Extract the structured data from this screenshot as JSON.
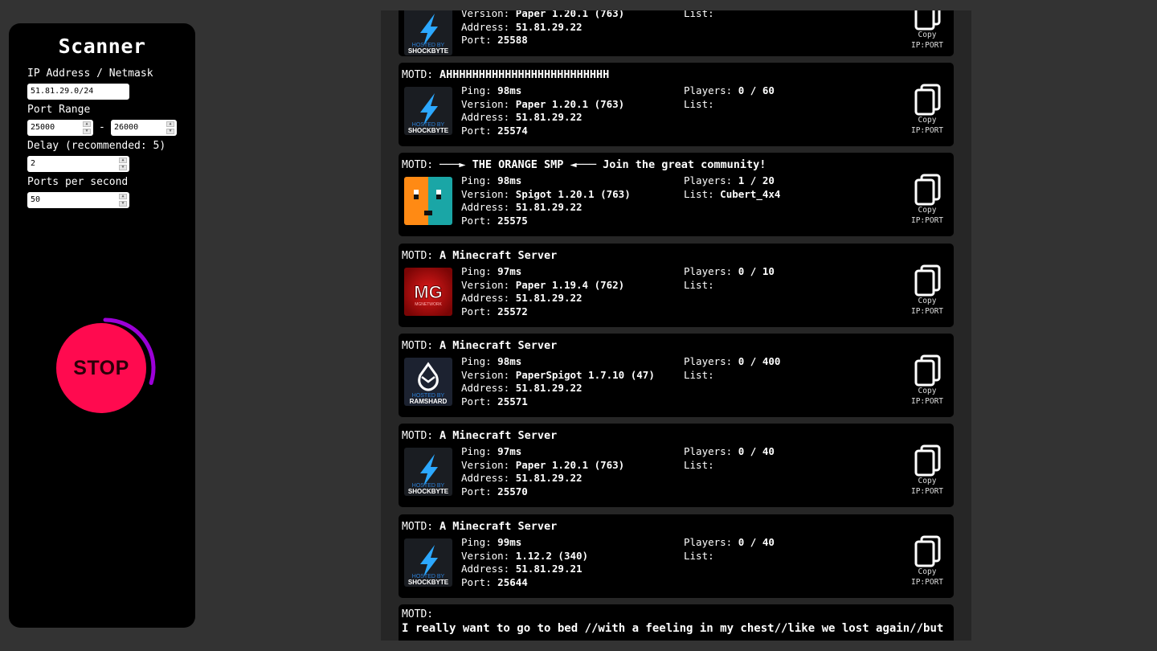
{
  "sidebar": {
    "title": "Scanner",
    "ip_label": "IP Address / Netmask",
    "ip_value": "51.81.29.0/24",
    "port_range_label": "Port Range",
    "port_from": "25000",
    "port_separator": "-",
    "port_to": "26000",
    "delay_label": "Delay (recommended: 5)",
    "delay_value": "2",
    "pps_label": "Ports per second",
    "pps_value": "50",
    "stop_label": "STOP",
    "progress_fraction": 0.3,
    "progress_color": "#9b00d8",
    "stop_color": "#ff0a4f"
  },
  "labels": {
    "motd": "MOTD:",
    "ping": "Ping:",
    "version": "Version:",
    "address": "Address:",
    "port": "Port:",
    "players": "Players:",
    "list": "List:",
    "copy_line1": "Copy",
    "copy_line2": "IP:PORT"
  },
  "servers": [
    {
      "motd": "",
      "ping": "",
      "version": "Paper 1.20.1 (763)",
      "address": "51.81.29.22",
      "port": "25588",
      "players": "",
      "list": "",
      "icon": "shockbyte-icon",
      "icon_text": "HOSTED BY\nSHOCKBYTE"
    },
    {
      "motd": "AHHHHHHHHHHHHHHHHHHHHHHHHH",
      "ping": "98ms",
      "version": "Paper 1.20.1 (763)",
      "address": "51.81.29.22",
      "port": "25574",
      "players": "0 / 60",
      "list": "",
      "icon": "shockbyte-icon",
      "icon_text": "HOSTED BY\nSHOCKBYTE"
    },
    {
      "motd": "───► THE ORANGE SMP ◄─── Join the great community!",
      "ping": "98ms",
      "version": "Spigot 1.20.1 (763)",
      "address": "51.81.29.22",
      "port": "25575",
      "players": "1 / 20",
      "list": "Cubert_4x4",
      "icon": "orange-teal-face-icon",
      "icon_text": ""
    },
    {
      "motd": "A Minecraft Server",
      "ping": "97ms",
      "version": "Paper 1.19.4 (762)",
      "address": "51.81.29.22",
      "port": "25572",
      "players": "0 / 10",
      "list": "",
      "icon": "mg-logo-icon",
      "icon_text": "MG"
    },
    {
      "motd": "A Minecraft Server",
      "ping": "98ms",
      "version": "PaperSpigot 1.7.10 (47)",
      "address": "51.81.29.22",
      "port": "25571",
      "players": "0 / 400",
      "list": "",
      "icon": "ramshard-icon",
      "icon_text": "HOSTED BY\nRAMSHARD"
    },
    {
      "motd": "A Minecraft Server",
      "ping": "97ms",
      "version": "Paper 1.20.1 (763)",
      "address": "51.81.29.22",
      "port": "25570",
      "players": "0 / 40",
      "list": "",
      "icon": "shockbyte-icon",
      "icon_text": "HOSTED BY\nSHOCKBYTE"
    },
    {
      "motd": "A Minecraft Server",
      "ping": "99ms",
      "version": "1.12.2 (340)",
      "address": "51.81.29.21",
      "port": "25644",
      "players": "0 / 40",
      "list": "",
      "icon": "shockbyte-icon",
      "icon_text": "HOSTED BY\nSHOCKBYTE"
    }
  ],
  "last_server": {
    "motd_text": "I really want to go to bed //with a feeling in my chest//like we lost again//but"
  }
}
